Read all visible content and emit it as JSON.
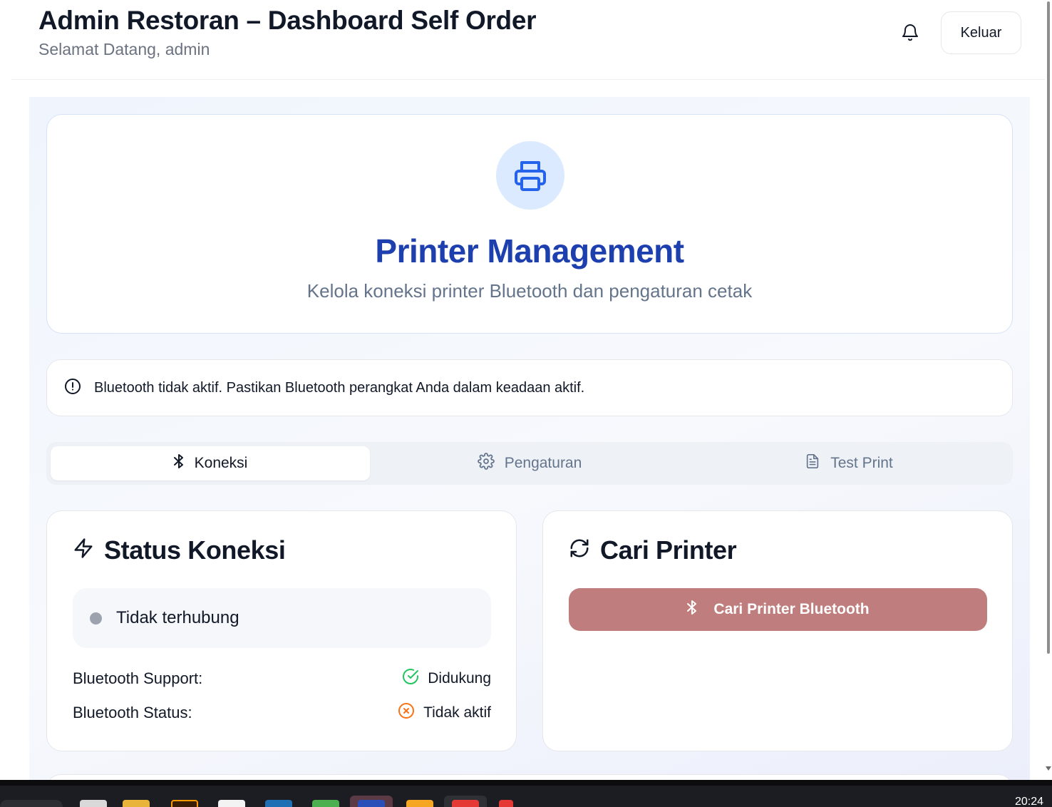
{
  "header": {
    "title": "Admin Restoran – Dashboard Self Order",
    "subtitle": "Selamat Datang, admin",
    "notification_icon": "bell-icon",
    "logout_label": "Keluar"
  },
  "hero": {
    "icon": "printer-icon",
    "title": "Printer Management",
    "subtitle": "Kelola koneksi printer Bluetooth dan pengaturan cetak"
  },
  "alert": {
    "icon": "alert-circle-icon",
    "message": "Bluetooth tidak aktif. Pastikan Bluetooth perangkat Anda dalam keadaan aktif."
  },
  "tabs": [
    {
      "label": "Koneksi",
      "icon": "bluetooth-icon",
      "active": true
    },
    {
      "label": "Pengaturan",
      "icon": "gear-icon",
      "active": false
    },
    {
      "label": "Test Print",
      "icon": "file-text-icon",
      "active": false
    }
  ],
  "status_card": {
    "title": "Status Koneksi",
    "icon": "lightning-icon",
    "connection_status": "Tidak terhubung",
    "support_label": "Bluetooth Support:",
    "support_value": "Didukung",
    "status_label": "Bluetooth Status:",
    "status_value": "Tidak aktif",
    "colors": {
      "supported": "#22c55e",
      "inactive": "#f97316",
      "dot": "#9ca3af"
    }
  },
  "search_card": {
    "title": "Cari Printer",
    "icon": "refresh-icon",
    "button_label": "Cari Printer Bluetooth",
    "button_color": "#c07d7d"
  },
  "taskbar": {
    "clock": "20:24"
  }
}
